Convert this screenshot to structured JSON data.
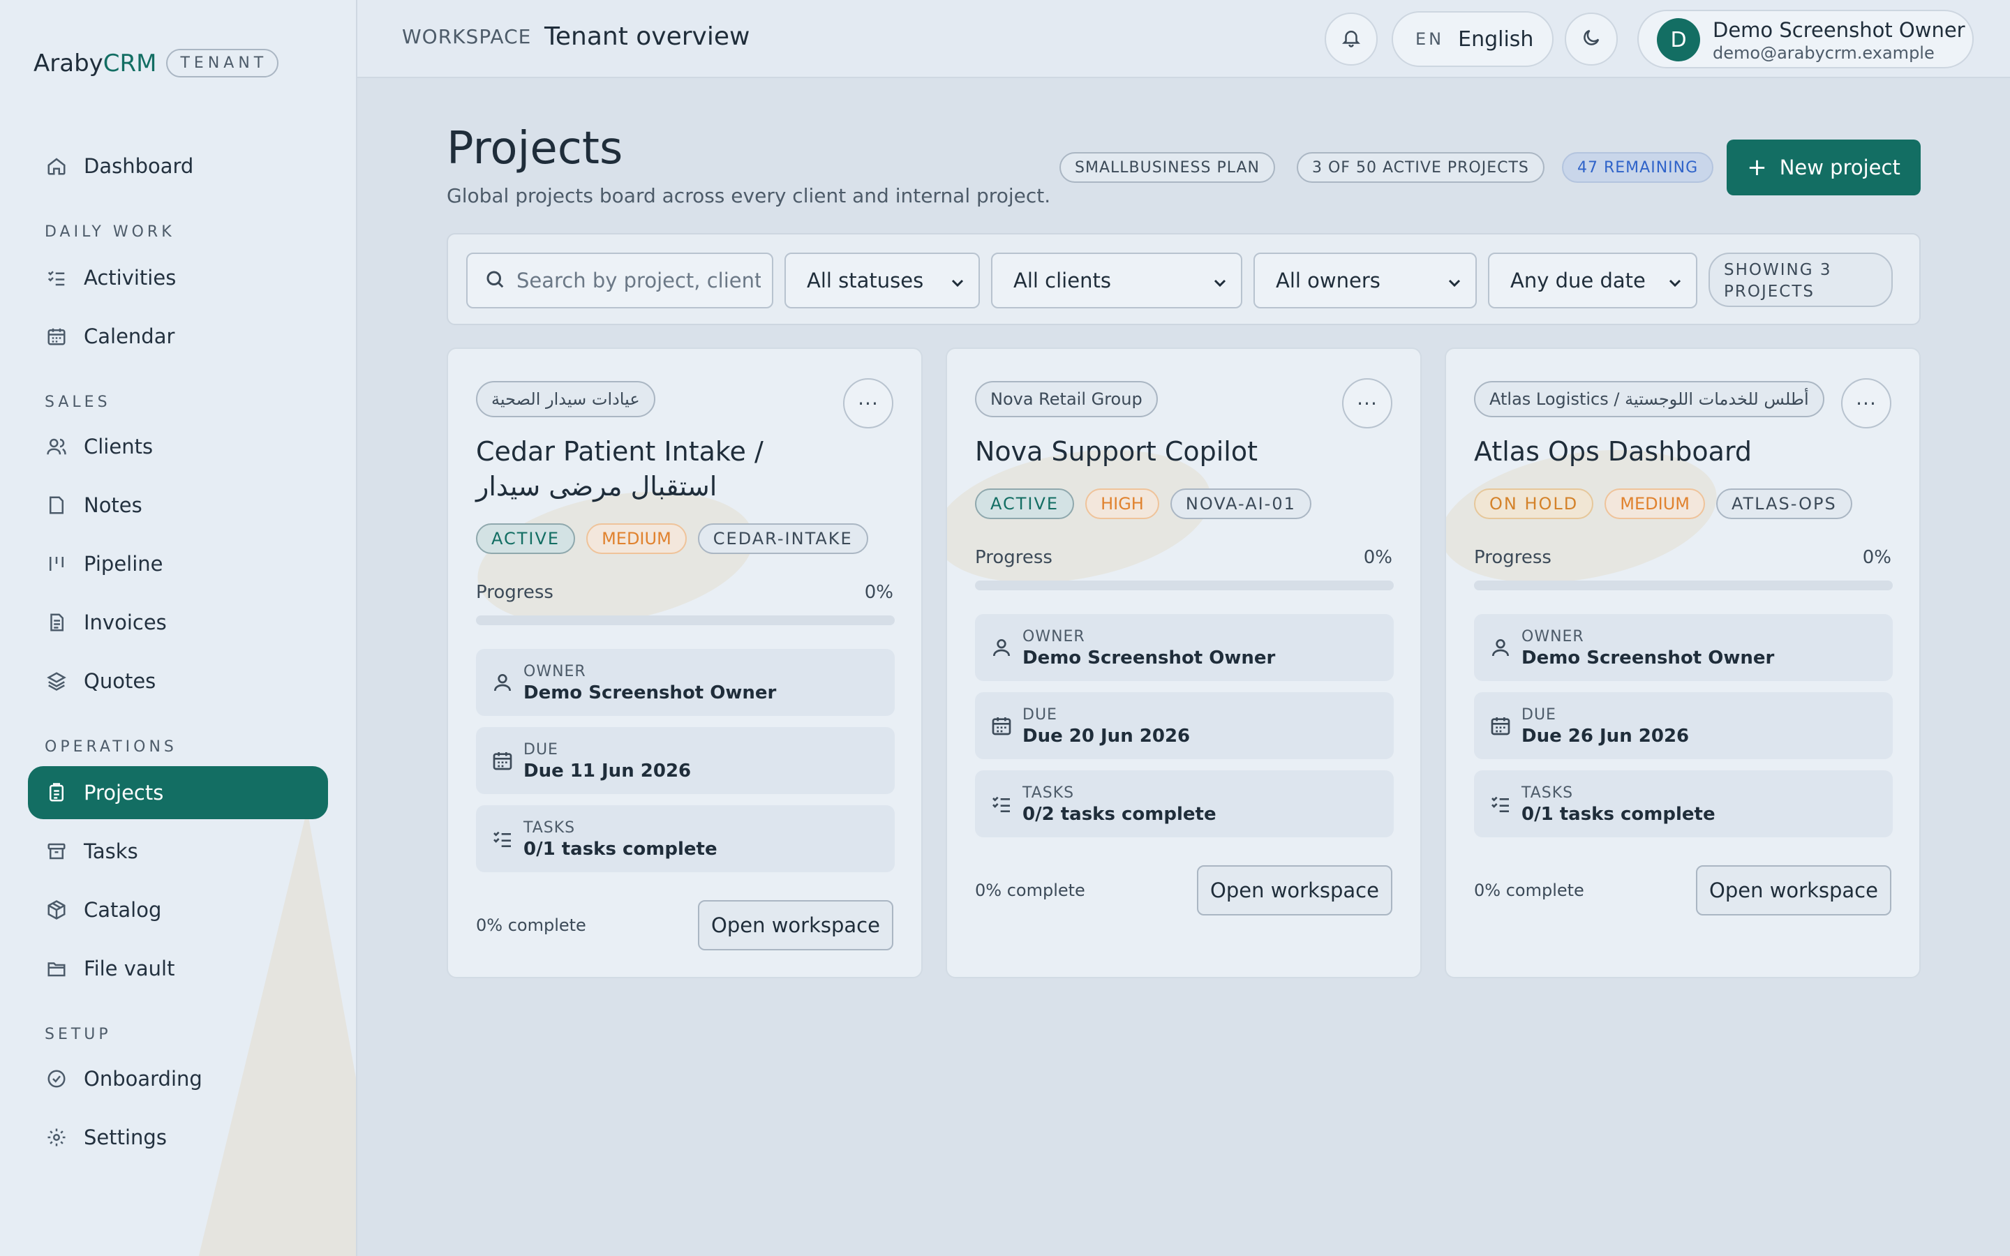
{
  "brand": {
    "name_prefix": "Araby",
    "name_suffix": "CRM",
    "badge": "TENANT"
  },
  "nav": {
    "dashboard": "Dashboard",
    "section_daily": "DAILY WORK",
    "activities": "Activities",
    "calendar": "Calendar",
    "section_sales": "SALES",
    "clients": "Clients",
    "notes": "Notes",
    "pipeline": "Pipeline",
    "invoices": "Invoices",
    "quotes": "Quotes",
    "section_operations": "OPERATIONS",
    "projects": "Projects",
    "tasks": "Tasks",
    "catalog": "Catalog",
    "file_vault": "File vault",
    "section_setup": "SETUP",
    "onboarding": "Onboarding",
    "settings": "Settings"
  },
  "topbar": {
    "workspace_label": "WORKSPACE",
    "title": "Tenant overview",
    "lang_code": "EN",
    "lang_name": "English",
    "user_initial": "D",
    "user_name": "Demo Screenshot Owner",
    "user_email": "demo@arabycrm.example"
  },
  "header": {
    "title": "Projects",
    "subtitle": "Global projects board across every client and internal project.",
    "plan": "SMALLBUSINESS PLAN",
    "usage": "3 OF 50 ACTIVE PROJECTS",
    "remaining": "47 REMAINING",
    "new_project": "New project"
  },
  "filters": {
    "search_placeholder": "Search by project, client",
    "status": "All statuses",
    "clients": "All clients",
    "owners": "All owners",
    "due": "Any due date",
    "showing": "SHOWING 3 PROJECTS"
  },
  "labels": {
    "progress": "Progress",
    "owner": "OWNER",
    "due": "DUE",
    "tasks": "TASKS",
    "open": "Open workspace",
    "more": "···"
  },
  "projects": [
    {
      "client": "عيادات سيدار الصحية",
      "title": "Cedar Patient Intake / استقبال مرضى سيدار",
      "status": "ACTIVE",
      "priority": "MEDIUM",
      "code": "CEDAR-INTAKE",
      "progress": "0%",
      "progress_fraction": 0,
      "owner": "Demo Screenshot Owner",
      "due": "Due 11 Jun 2026",
      "tasks": "0/1 tasks complete",
      "complete": "0% complete"
    },
    {
      "client": "Nova Retail Group",
      "title": "Nova Support Copilot",
      "status": "ACTIVE",
      "priority": "HIGH",
      "code": "NOVA-AI-01",
      "progress": "0%",
      "progress_fraction": 0,
      "owner": "Demo Screenshot Owner",
      "due": "Due 20 Jun 2026",
      "tasks": "0/2 tasks complete",
      "complete": "0% complete"
    },
    {
      "client": "Atlas Logistics / أطلس للخدمات اللوجستية",
      "title": "Atlas Ops Dashboard",
      "status": "ON HOLD",
      "priority": "MEDIUM",
      "code": "ATLAS-OPS",
      "progress": "0%",
      "progress_fraction": 0,
      "owner": "Demo Screenshot Owner",
      "due": "Due 26 Jun 2026",
      "tasks": "0/1 tasks complete",
      "complete": "0% complete"
    }
  ]
}
